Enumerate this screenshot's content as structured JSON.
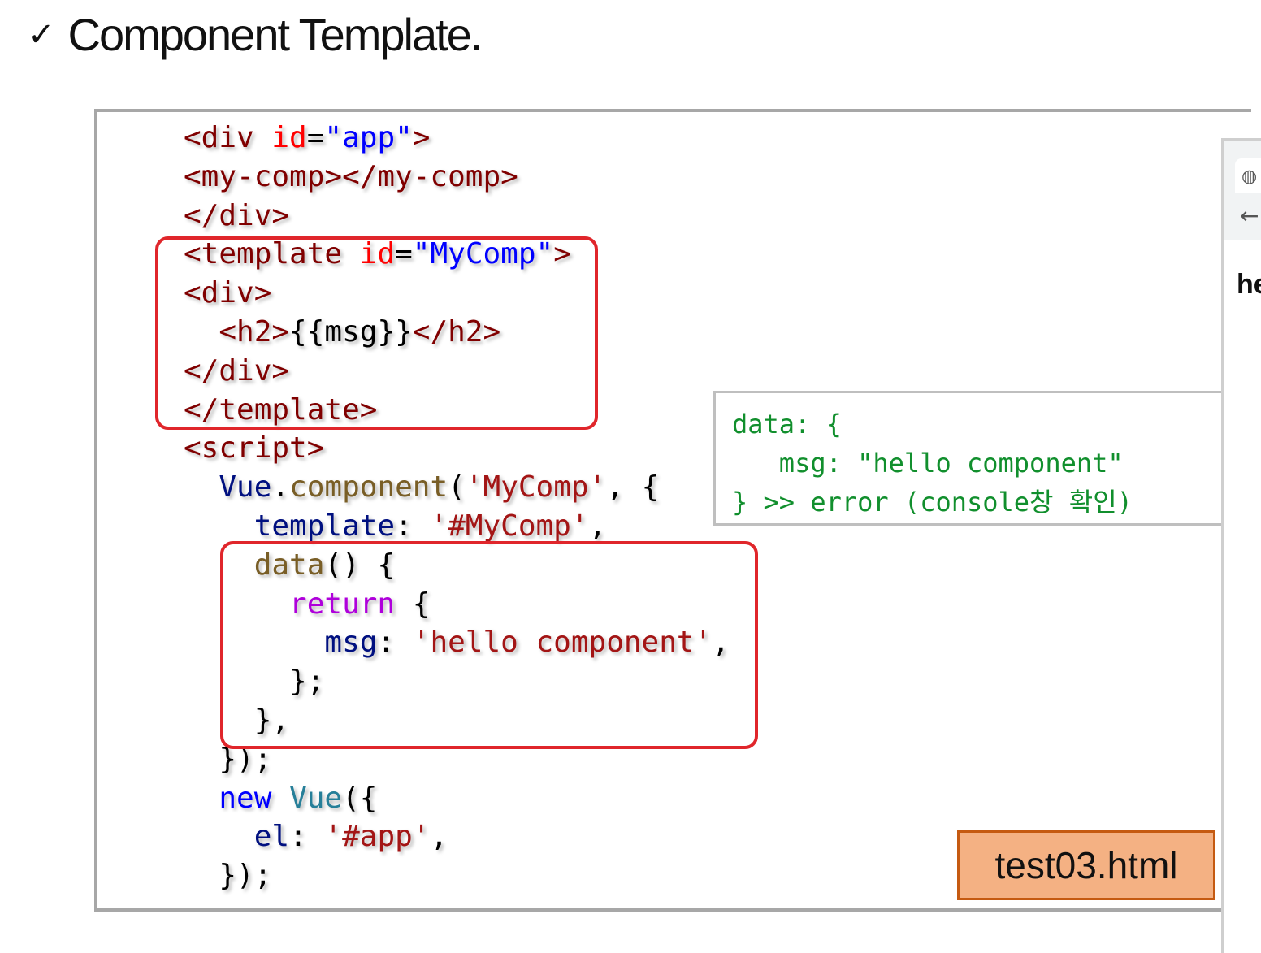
{
  "title": {
    "check": "✓",
    "text": "Component Template."
  },
  "code_lines": [
    [
      [
        "  ",
        "punct"
      ],
      [
        "<div",
        "tag"
      ],
      [
        " id",
        "attr"
      ],
      [
        "=",
        "punct"
      ],
      [
        "\"app\"",
        "val"
      ],
      [
        ">",
        "tag"
      ]
    ],
    [
      [
        "  ",
        "punct"
      ],
      [
        "  <my-comp></my-comp>",
        "tag"
      ]
    ],
    [
      [
        "  ",
        "punct"
      ],
      [
        "</div>",
        "tag"
      ]
    ],
    [
      [
        "  ",
        "punct"
      ],
      [
        "<template",
        "tag"
      ],
      [
        " id",
        "attr"
      ],
      [
        "=",
        "punct"
      ],
      [
        "\"MyComp\"",
        "val"
      ],
      [
        ">",
        "tag"
      ]
    ],
    [
      [
        "  ",
        "punct"
      ],
      [
        "  <div>",
        "tag"
      ]
    ],
    [
      [
        "  ",
        "punct"
      ],
      [
        "    <h2>",
        "tag"
      ],
      [
        "{{msg}}",
        "punct"
      ],
      [
        "</h2>",
        "tag"
      ]
    ],
    [
      [
        "  ",
        "punct"
      ],
      [
        "  </div>",
        "tag"
      ]
    ],
    [
      [
        "  ",
        "punct"
      ],
      [
        "</template>",
        "tag"
      ]
    ],
    [
      [
        "  ",
        "punct"
      ],
      [
        "<script>",
        "tag"
      ]
    ],
    [
      [
        "    ",
        "punct"
      ],
      [
        "Vue",
        "ident"
      ],
      [
        ".",
        "punct"
      ],
      [
        "component",
        "func"
      ],
      [
        "(",
        "punct"
      ],
      [
        "'MyComp'",
        "str"
      ],
      [
        ", {",
        "punct"
      ]
    ],
    [
      [
        "      ",
        "punct"
      ],
      [
        "template",
        "ident"
      ],
      [
        ": ",
        "punct"
      ],
      [
        "'#MyComp'",
        "str"
      ],
      [
        ",",
        "punct"
      ]
    ],
    [
      [
        "      ",
        "punct"
      ],
      [
        "data",
        "func"
      ],
      [
        "() {",
        "punct"
      ]
    ],
    [
      [
        "        ",
        "punct"
      ],
      [
        "return",
        "kw"
      ],
      [
        " {",
        "punct"
      ]
    ],
    [
      [
        "          ",
        "punct"
      ],
      [
        "msg",
        "ident"
      ],
      [
        ": ",
        "punct"
      ],
      [
        "'hello component'",
        "str"
      ],
      [
        ",",
        "punct"
      ]
    ],
    [
      [
        "        ",
        "punct"
      ],
      [
        "};",
        "punct"
      ]
    ],
    [
      [
        "      ",
        "punct"
      ],
      [
        "},",
        "punct"
      ]
    ],
    [
      [
        "    ",
        "punct"
      ],
      [
        "});",
        "punct"
      ]
    ],
    [
      [
        "    ",
        "punct"
      ],
      [
        "new",
        "kwb"
      ],
      [
        " ",
        "punct"
      ],
      [
        "Vue",
        "cls"
      ],
      [
        "({",
        "punct"
      ]
    ],
    [
      [
        "      ",
        "punct"
      ],
      [
        "el",
        "ident"
      ],
      [
        ": ",
        "punct"
      ],
      [
        "'#app'",
        "str"
      ],
      [
        ",",
        "punct"
      ]
    ],
    [
      [
        "    ",
        "punct"
      ],
      [
        "});",
        "punct"
      ]
    ]
  ],
  "note": {
    "line1": "data: {",
    "line2": "   msg: \"hello component\"",
    "line3": "} >> error (console창 확인)"
  },
  "file_label": "test03.html",
  "browser": {
    "tab_icon": "globe-icon",
    "back_icon": "arrow-left-icon",
    "partial_text": "he"
  },
  "colors": {
    "tag": "#800000",
    "attr": "#ff0000",
    "val": "#0000ff",
    "ident": "#001080",
    "func": "#795e26",
    "str": "#a31515",
    "kw": "#af00db",
    "kwb": "#0000ff",
    "cls": "#267f99",
    "highlight": "#e0262b",
    "note_text": "#118f2d",
    "file_bg": "#f4b183"
  }
}
